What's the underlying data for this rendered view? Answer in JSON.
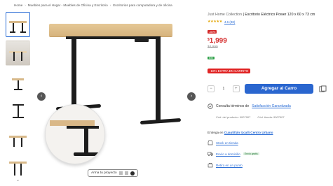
{
  "breadcrumb": [
    "Home",
    "Muebles para el Hogar - Muebles de Oficina y Escritorio",
    "Escritorios para computadora y de oficina"
  ],
  "gallery": {
    "thumbnails": [
      "desk-front",
      "desk-room-photo",
      "desk-side",
      "desk-frame",
      "desk-angle",
      "desk-legs"
    ],
    "prev_icon": "chevron-left-icon",
    "next_icon": "chevron-right-icon",
    "project_button": "Arma tu proyecto"
  },
  "product": {
    "brand": "Just Home Collection",
    "title": "| Escritorio Eléctrico Power 120 x 60 x 73 cm",
    "rating_value": 4.6,
    "rating_text": "4.6 (38)",
    "stars": "★★★★★",
    "discount_badge": "-60%",
    "currency": "$",
    "price": "1,999",
    "old_price": "$4,999",
    "env_badge": "EM",
    "promo_badge": "-10% EXTRA EN CARRITO",
    "quantity": "1",
    "minus": "−",
    "plus": "+",
    "add_to_cart": "Agregar al Carro",
    "warranty_prefix": "Consulta términos de",
    "warranty_link": "Satisfacción Garantizada",
    "code_product": "Cód. del producto: 9007907",
    "code_store": "Cód. tienda: 9007907"
  },
  "delivery": {
    "title_prefix": "Entrega en",
    "location": "Cuautitlán Izcalli Centro Urbano",
    "options": [
      {
        "label": "Stock en tienda",
        "icon": "store-icon"
      },
      {
        "label": "Envío a domicilio",
        "icon": "truck-icon",
        "badge": "Envío gratis"
      },
      {
        "label": "Retiro en un punto",
        "icon": "pickup-icon"
      }
    ]
  },
  "colors": {
    "accent": "#2a66cf",
    "sale": "#d42a2a",
    "star": "#e2a400",
    "eco": "#33a34d"
  }
}
